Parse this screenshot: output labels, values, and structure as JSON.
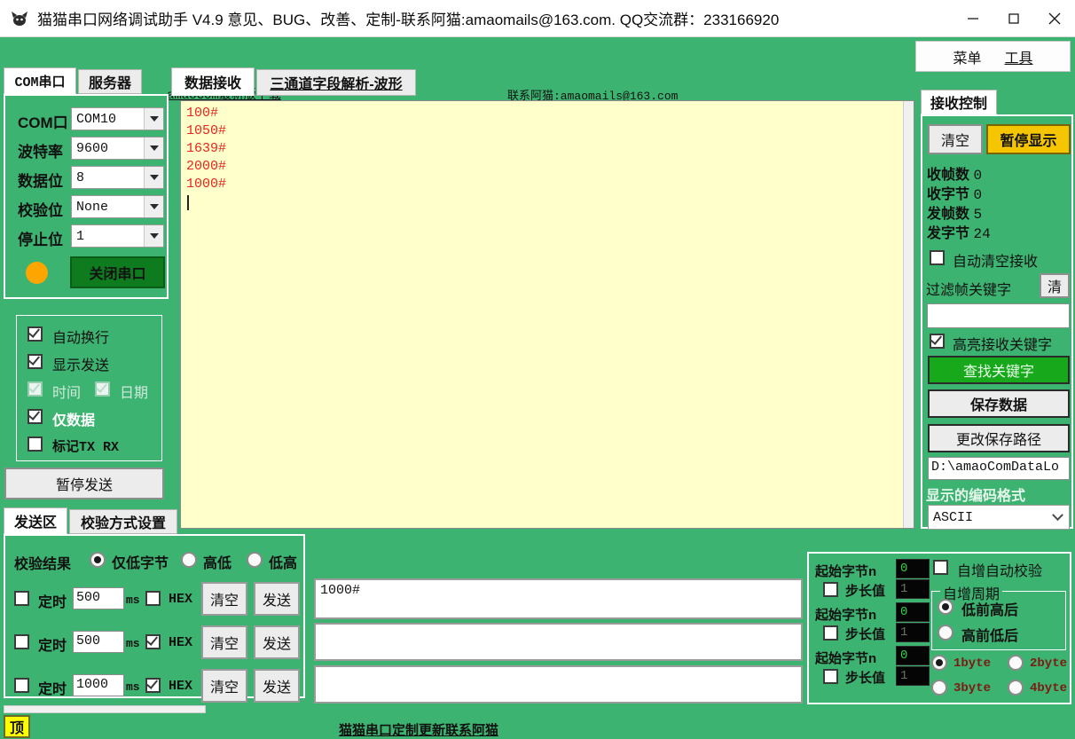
{
  "window": {
    "title": "猫猫串口网络调试助手 V4.9 意见、BUG、改善、定制-联系阿猫:amaomails@163.com. QQ交流群：233166920",
    "minimize": "—",
    "maximize": "□",
    "close": "✕"
  },
  "toplinks": {
    "download": "amaoCom最新版下载",
    "contact": "联系阿猫:amaomails@163.com"
  },
  "menubar": {
    "menu": "菜单",
    "tools": "工具"
  },
  "left_tabs": [
    {
      "label": "COM串口",
      "active": true
    },
    {
      "label": "服务器",
      "active": false
    }
  ],
  "serial": {
    "rows": [
      {
        "label": "COM口",
        "value": "COM10"
      },
      {
        "label": "波特率",
        "value": "9600"
      },
      {
        "label": "数据位",
        "value": "8"
      },
      {
        "label": "校验位",
        "value": "None"
      },
      {
        "label": "停止位",
        "value": "1"
      }
    ],
    "status_color": "#FFA500",
    "close_button": "关闭串口"
  },
  "display_options": [
    {
      "label": "自动换行",
      "checked": true,
      "dim": false,
      "bold": false
    },
    {
      "label": "显示发送",
      "checked": true,
      "dim": false,
      "bold": false
    },
    {
      "label": "时间",
      "checked": true,
      "dim": true,
      "bold": false
    },
    {
      "label": "日期",
      "checked": true,
      "dim": true,
      "bold": false
    },
    {
      "label": "仅数据",
      "checked": true,
      "dim": false,
      "bold": true
    },
    {
      "label": "标记TX RX",
      "checked": false,
      "dim": false,
      "bold": false
    }
  ],
  "pause_send_button": "暂停发送",
  "send_tabs": [
    {
      "label": "发送区",
      "active": true
    },
    {
      "label": "校验方式设置",
      "active": false
    }
  ],
  "main_tabs": [
    {
      "label": "数据接收",
      "active": true
    },
    {
      "label": "三通道字段解析-波形",
      "active": false
    }
  ],
  "receive": {
    "lines": [
      "100#",
      "1050#",
      "1639#",
      "2000#",
      "1000#"
    ],
    "text_color": "#E8241B",
    "bg_color": "#FFFFCC"
  },
  "recv_control": {
    "tab_label": "接收控制",
    "clear_button": "清空",
    "pause_button": "暂停显示",
    "stats": [
      {
        "label": "收帧数",
        "value": "0"
      },
      {
        "label": "收字节",
        "value": "0"
      },
      {
        "label": "发帧数",
        "value": "5"
      },
      {
        "label": "发字节",
        "value": "24"
      }
    ],
    "auto_clear": {
      "label": "自动清空接收",
      "checked": false
    },
    "filter_label": "过滤帧关键字",
    "filter_clear_button": "清",
    "filter_value": "",
    "highlight": {
      "label": "高亮接收关键字",
      "checked": true
    },
    "find_button": "查找关键字",
    "save_button": "保存数据",
    "change_path_button": "更改保存路径",
    "save_path": "D:\\amaoComDataLo",
    "encoding_label": "显示的编码格式",
    "encoding_value": "ASCII"
  },
  "checksum": {
    "result_label": "校验结果",
    "options": [
      {
        "label": "仅低字节",
        "selected": true
      },
      {
        "label": "高低",
        "selected": false
      },
      {
        "label": "低高",
        "selected": false
      }
    ]
  },
  "send_rows": [
    {
      "timer_label": "定时",
      "timer_checked": false,
      "interval": "500",
      "ms": "ms",
      "hex_label": "HEX",
      "hex_checked": false,
      "clear": "清空",
      "send": "发送",
      "text": "1000#"
    },
    {
      "timer_label": "定时",
      "timer_checked": false,
      "interval": "500",
      "ms": "ms",
      "hex_label": "HEX",
      "hex_checked": true,
      "clear": "清空",
      "send": "发送",
      "text": ""
    },
    {
      "timer_label": "定时",
      "timer_checked": false,
      "interval": "1000",
      "ms": "ms",
      "hex_label": "HEX",
      "hex_checked": true,
      "clear": "清空",
      "send": "发送",
      "text": ""
    }
  ],
  "auto_inc": {
    "rows": [
      {
        "start_label": "起始字节n",
        "start_value": "0",
        "step_label": "步长值",
        "step_value": "1",
        "step_checked": false
      },
      {
        "start_label": "起始字节n",
        "start_value": "0",
        "step_label": "步长值",
        "step_value": "1",
        "step_checked": false
      },
      {
        "start_label": "起始字节n",
        "start_value": "0",
        "step_label": "步长值",
        "step_value": "1",
        "step_checked": false
      }
    ],
    "auto_check": {
      "label": "自增自动校验",
      "checked": false
    },
    "period_label": "自增周期",
    "order_options": [
      {
        "label": "低前高后",
        "selected": true
      },
      {
        "label": "高前低后",
        "selected": false
      }
    ],
    "byte_options": [
      {
        "label": "1byte",
        "selected": true
      },
      {
        "label": "2byte",
        "selected": false
      },
      {
        "label": "3byte",
        "selected": false
      },
      {
        "label": "4byte",
        "selected": false
      }
    ]
  },
  "statusbar": {
    "top_button": "顶",
    "link": "猫猫串口定制更新联系阿猫"
  }
}
